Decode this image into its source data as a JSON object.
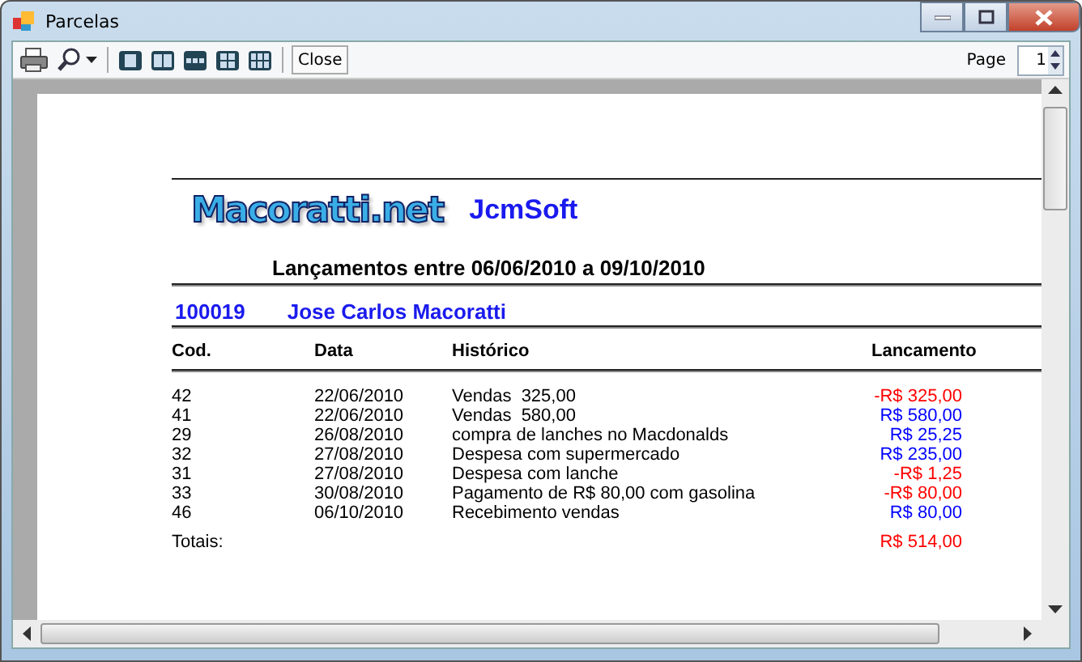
{
  "window": {
    "title": "Parcelas"
  },
  "toolbar": {
    "close_button": "Close",
    "page_label": "Page",
    "page_value": "1"
  },
  "report": {
    "logo": "Macoratti.net",
    "company": "JcmSoft",
    "title": "Lançamentos entre 06/06/2010 a 09/10/2010",
    "client_code": "100019",
    "client_name": "Jose Carlos Macoratti",
    "columns": [
      "Cod.",
      "Data",
      "Histórico",
      "Lancamento"
    ],
    "rows": [
      {
        "cod": "42",
        "data": "22/06/2010",
        "historico": "Vendas  325,00",
        "lancamento": "-R$ 325,00",
        "color": "#ff0000"
      },
      {
        "cod": "41",
        "data": "22/06/2010",
        "historico": "Vendas  580,00",
        "lancamento": "R$ 580,00",
        "color": "#0000ff"
      },
      {
        "cod": "29",
        "data": "26/08/2010",
        "historico": "compra de lanches no Macdonalds",
        "lancamento": "R$ 25,25",
        "color": "#0000ff"
      },
      {
        "cod": "32",
        "data": "27/08/2010",
        "historico": "Despesa com supermercado",
        "lancamento": "R$ 235,00",
        "color": "#0000ff"
      },
      {
        "cod": "31",
        "data": "27/08/2010",
        "historico": "Despesa com lanche",
        "lancamento": "-R$ 1,25",
        "color": "#ff0000"
      },
      {
        "cod": "33",
        "data": "30/08/2010",
        "historico": "Pagamento de R$ 80,00 com gasolina",
        "lancamento": "-R$ 80,00",
        "color": "#ff0000"
      },
      {
        "cod": "46",
        "data": "06/10/2010",
        "historico": "Recebimento vendas",
        "lancamento": "R$ 80,00",
        "color": "#0000ff"
      }
    ],
    "totals": {
      "label": "Totais:",
      "value": "R$ 514,00",
      "color": "#ff0000"
    }
  }
}
